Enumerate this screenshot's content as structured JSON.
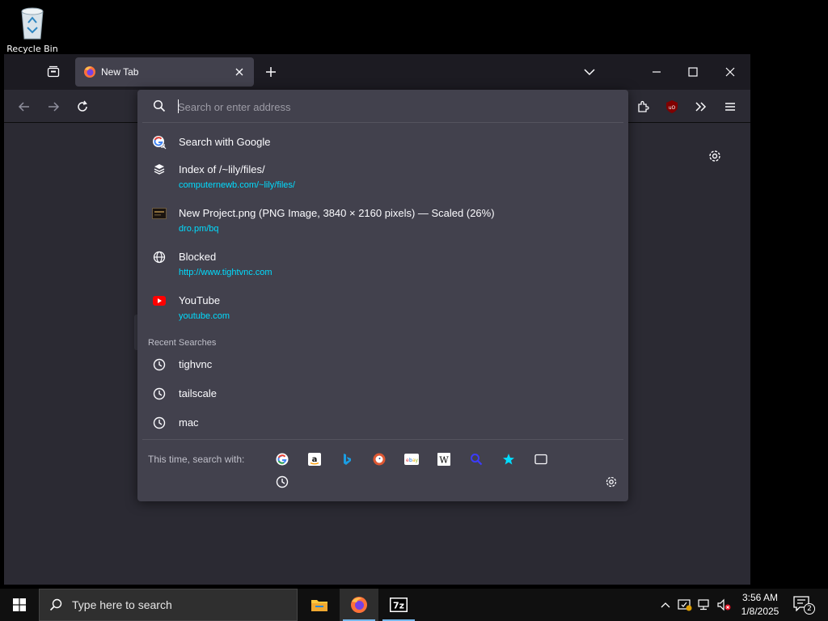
{
  "desktop": {
    "recycle_bin_label": "Recycle Bin"
  },
  "browser": {
    "tab_title": "New Tab",
    "urlbar": {
      "placeholder": "Search or enter address",
      "value": "",
      "results": [
        {
          "icon": "google-icon",
          "title": "Search with Google",
          "url": ""
        },
        {
          "icon": "site-icon",
          "title": "Index of /~lily/files/",
          "url": "computernewb.com/~lily/files/"
        },
        {
          "icon": "image-thumb-icon",
          "title": "New Project.png (PNG Image, 3840 × 2160 pixels) — Scaled (26%)",
          "url": "dro.pm/bq"
        },
        {
          "icon": "globe-icon",
          "title": "Blocked",
          "url": "http://www.tightvnc.com"
        },
        {
          "icon": "youtube-icon",
          "title": "YouTube",
          "url": "youtube.com"
        }
      ],
      "recent_label": "Recent Searches",
      "recent": [
        "tighvnc",
        "tailscale",
        "mac"
      ],
      "oneoff_label": "This time, search with:",
      "oneoff_engines": [
        "google-icon",
        "amazon-icon",
        "bing-icon",
        "duckduckgo-icon",
        "ebay-icon",
        "wikipedia-icon",
        "search-engine-icon",
        "bookmarks-icon",
        "tabs-icon",
        "history-icon"
      ]
    }
  },
  "taskbar": {
    "search_placeholder": "Type here to search",
    "time": "3:56 AM",
    "date": "1/8/2025",
    "notification_count": "2",
    "apps": [
      "file-explorer-icon",
      "firefox-icon",
      "7zip-icon"
    ]
  },
  "colors": {
    "accent": "#00ddff",
    "panel": "#42414d",
    "toolbar": "#2b2a33",
    "taskbar": "#101010"
  }
}
